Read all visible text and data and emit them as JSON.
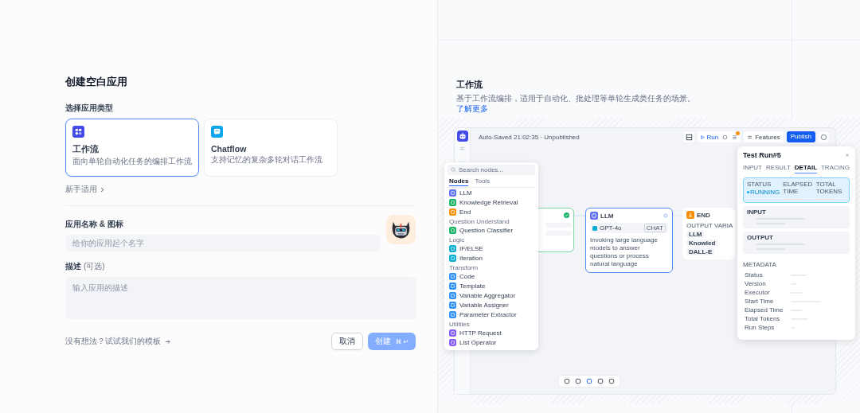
{
  "left": {
    "title": "创建空白应用",
    "type_label": "选择应用类型",
    "app_types": [
      {
        "kind": "workflow",
        "title": "工作流",
        "description": "面向单轮自动化任务的编排工作流",
        "selected": true
      },
      {
        "kind": "chatflow",
        "title": "Chatflow",
        "description": "支持记忆的复杂多轮对话工作流",
        "selected": false
      }
    ],
    "beginner_link": "新手适用",
    "name_label": "应用名称 & 图标",
    "name_placeholder": "给你的应用起个名字",
    "desc_label": "描述",
    "desc_optional": "(可选)",
    "desc_placeholder": "输入应用的描述",
    "template_link": "没有想法？试试我们的模板",
    "cancel_button": "取消",
    "create_button": {
      "label": "创建",
      "shortcut": "⌘ ↵",
      "disabled": true
    }
  },
  "right": {
    "title": "工作流",
    "description": "基于工作流编排，适用于自动化、批处理等单轮生成类任务的场景。",
    "learn_more": "了解更多",
    "preview": {
      "save_status": "Auto-Saved 21:02:35 · Unpublished",
      "run_button": "Run",
      "features_button": "Features",
      "publish_button": "Publish",
      "node_panel": {
        "search_placeholder": "Search nodes...",
        "tabs": [
          {
            "label": "Nodes",
            "selected": true
          },
          {
            "label": "Tools",
            "selected": false
          }
        ],
        "groups": [
          {
            "items": [
              {
                "label": "LLM",
                "color": "#6172f3"
              },
              {
                "label": "Knowledge Retrieval",
                "color": "#16b364"
              },
              {
                "label": "End",
                "color": "#f79009"
              }
            ]
          },
          {
            "heading": "Question Understand",
            "items": [
              {
                "label": "Question Classifier",
                "color": "#16b364"
              }
            ]
          },
          {
            "heading": "Logic",
            "items": [
              {
                "label": "IF/ELSE",
                "color": "#06aed4"
              },
              {
                "label": "Iteration",
                "color": "#06aed4"
              }
            ]
          },
          {
            "heading": "Transform",
            "items": [
              {
                "label": "Code",
                "color": "#2e90fa"
              },
              {
                "label": "Template",
                "color": "#2e90fa"
              },
              {
                "label": "Variable Aggregator",
                "color": "#2e90fa"
              },
              {
                "label": "Variable Assigner",
                "color": "#2e90fa"
              },
              {
                "label": "Parameter Extractor",
                "color": "#2e90fa"
              }
            ]
          },
          {
            "heading": "Utilities",
            "items": [
              {
                "label": "HTTP Request",
                "color": "#875bf7"
              },
              {
                "label": "List Operator",
                "color": "#875bf7"
              }
            ]
          }
        ]
      },
      "llm_node": {
        "title": "LLM",
        "model": "GPT-4o",
        "mode": "CHAT",
        "description": "Invoking large language models to answer questions or process natural language"
      },
      "end_node": {
        "title": "END",
        "output_label": "OUTPUT VARIA",
        "outputs": [
          "LLM",
          "Knowled",
          "DALL-E"
        ]
      },
      "test_run": {
        "title": "Test Run#5",
        "tabs": [
          {
            "label": "INPUT",
            "selected": false
          },
          {
            "label": "RESULT",
            "selected": false
          },
          {
            "label": "DETAIL",
            "selected": true
          },
          {
            "label": "TRACING",
            "selected": false
          }
        ],
        "status_labels": [
          "STATUS",
          "ELAPSED TIME",
          "TOTAL TOKENS"
        ],
        "status_value": "RUNNING",
        "input_label": "INPUT",
        "output_label": "OUTPUT",
        "metadata_label": "METADATA",
        "metadata_rows": [
          "Status",
          "Version",
          "Executor",
          "Start Time",
          "Elapsed Time",
          "Total Tokens",
          "Run Steps"
        ]
      }
    }
  }
}
